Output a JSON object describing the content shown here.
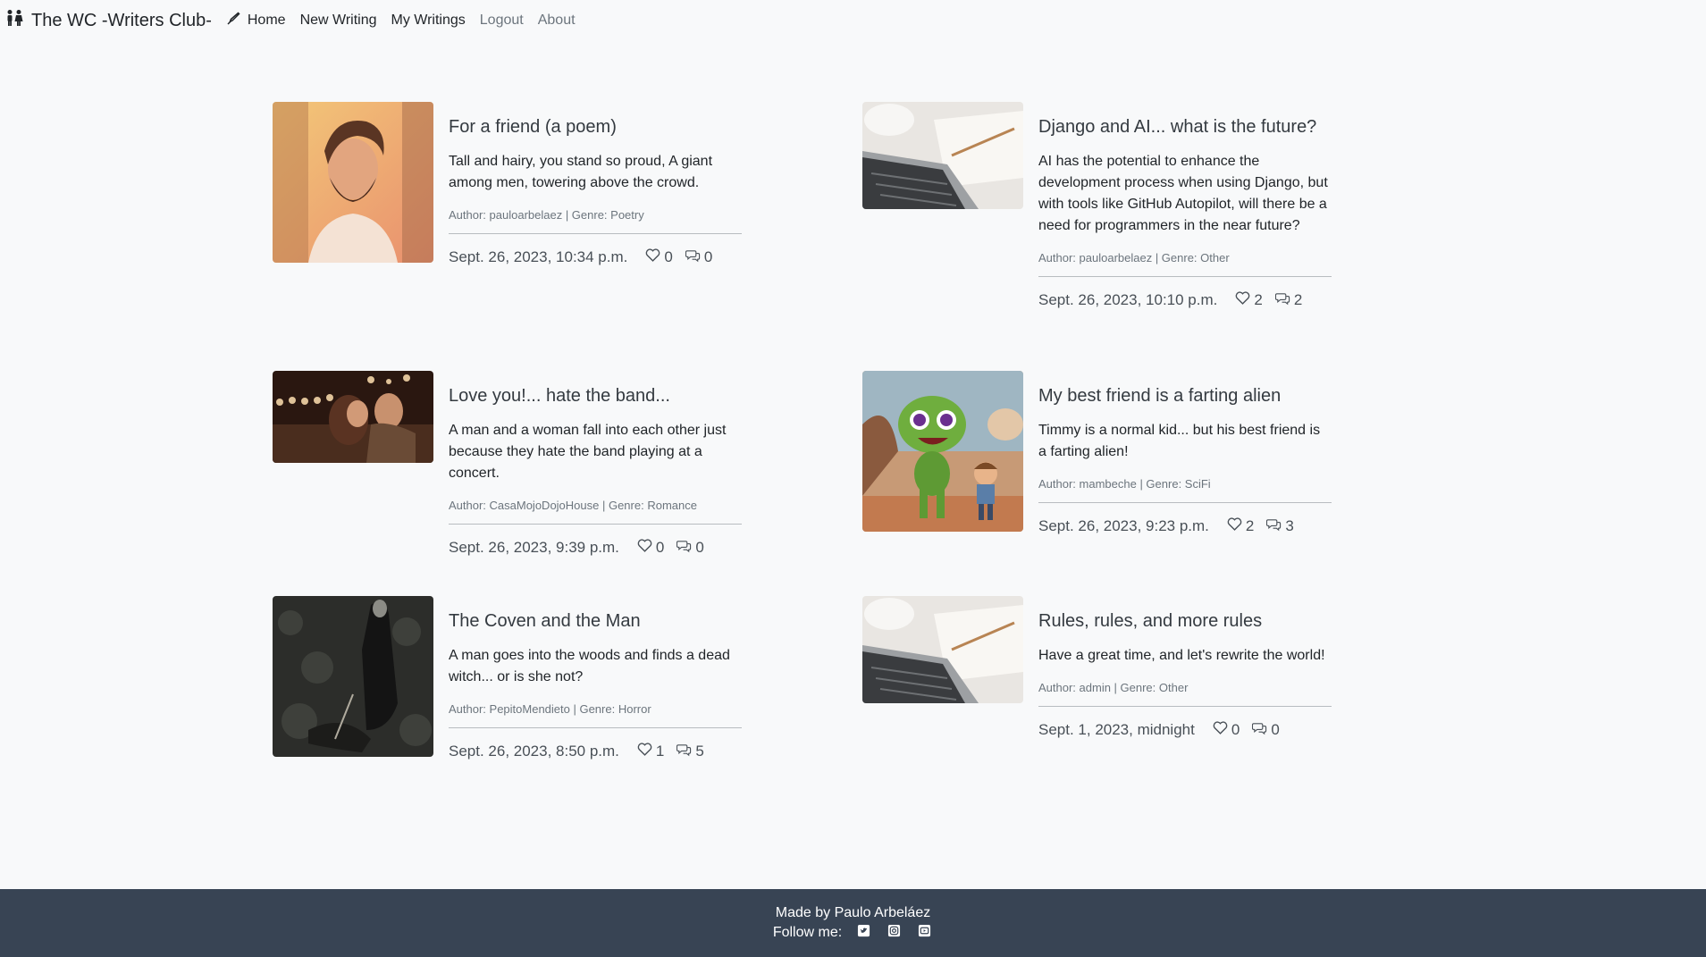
{
  "nav": {
    "brand": "The WC -Writers Club-",
    "links": [
      {
        "label": "Home",
        "icon": "pen-icon",
        "muted": false
      },
      {
        "label": "New Writing",
        "muted": false
      },
      {
        "label": "My Writings",
        "muted": false
      },
      {
        "label": "Logout",
        "muted": true
      },
      {
        "label": "About",
        "muted": true
      }
    ]
  },
  "posts": [
    {
      "title": "For a friend (a poem)",
      "summary": "Tall and hairy, you stand so proud, A giant among men, towering above the crowd.",
      "meta": "Author: pauloarbelaez | Genre: Poetry",
      "date": "Sept. 26, 2023, 10:34 p.m.",
      "likes": "0",
      "comments": "0",
      "image": "bearded-man-portrait"
    },
    {
      "title": "Django and AI... what is the future?",
      "summary": "AI has the potential to enhance the development process when using Django, but with tools like GitHub Autopilot, will there be a need for programmers in the near future?",
      "meta": "Author: pauloarbelaez | Genre: Other",
      "date": "Sept. 26, 2023, 10:10 p.m.",
      "likes": "2",
      "comments": "2",
      "image": "laptop-notebook"
    },
    {
      "title": "Love you!... hate the band...",
      "summary": "A man and a woman fall into each other just because they hate the band playing at a concert.",
      "meta": "Author: CasaMojoDojoHouse | Genre: Romance",
      "date": "Sept. 26, 2023, 9:39 p.m.",
      "likes": "0",
      "comments": "0",
      "image": "couple-kissing-concert"
    },
    {
      "title": "My best friend is a farting alien",
      "summary": "Timmy is a normal kid... but his best friend is a farting alien!",
      "meta": "Author: mambeche | Genre: SciFi",
      "date": "Sept. 26, 2023, 9:23 p.m.",
      "likes": "2",
      "comments": "3",
      "image": "green-alien-and-boy"
    },
    {
      "title": "The Coven and the Man",
      "summary": "A man goes into the woods and finds a dead witch... or is she not?",
      "meta": "Author: PepitoMendieto | Genre: Horror",
      "date": "Sept. 26, 2023, 8:50 p.m.",
      "likes": "1",
      "comments": "5",
      "image": "dark-woods-figure"
    },
    {
      "title": "Rules, rules, and more rules",
      "summary": "Have a great time, and let's rewrite the world!",
      "meta": "Author: admin | Genre: Other",
      "date": "Sept. 1, 2023, midnight",
      "likes": "0",
      "comments": "0",
      "image": "laptop-notebook"
    }
  ],
  "footer": {
    "made_by": "Made by Paulo Arbeláez",
    "follow": "Follow me:",
    "socials": [
      "twitter-icon",
      "instagram-icon",
      "youtube-icon"
    ]
  },
  "colors": {
    "page_bg": "#f8f9fa",
    "footer_bg": "#384454",
    "title": "#343a40",
    "muted": "#6c757d"
  }
}
